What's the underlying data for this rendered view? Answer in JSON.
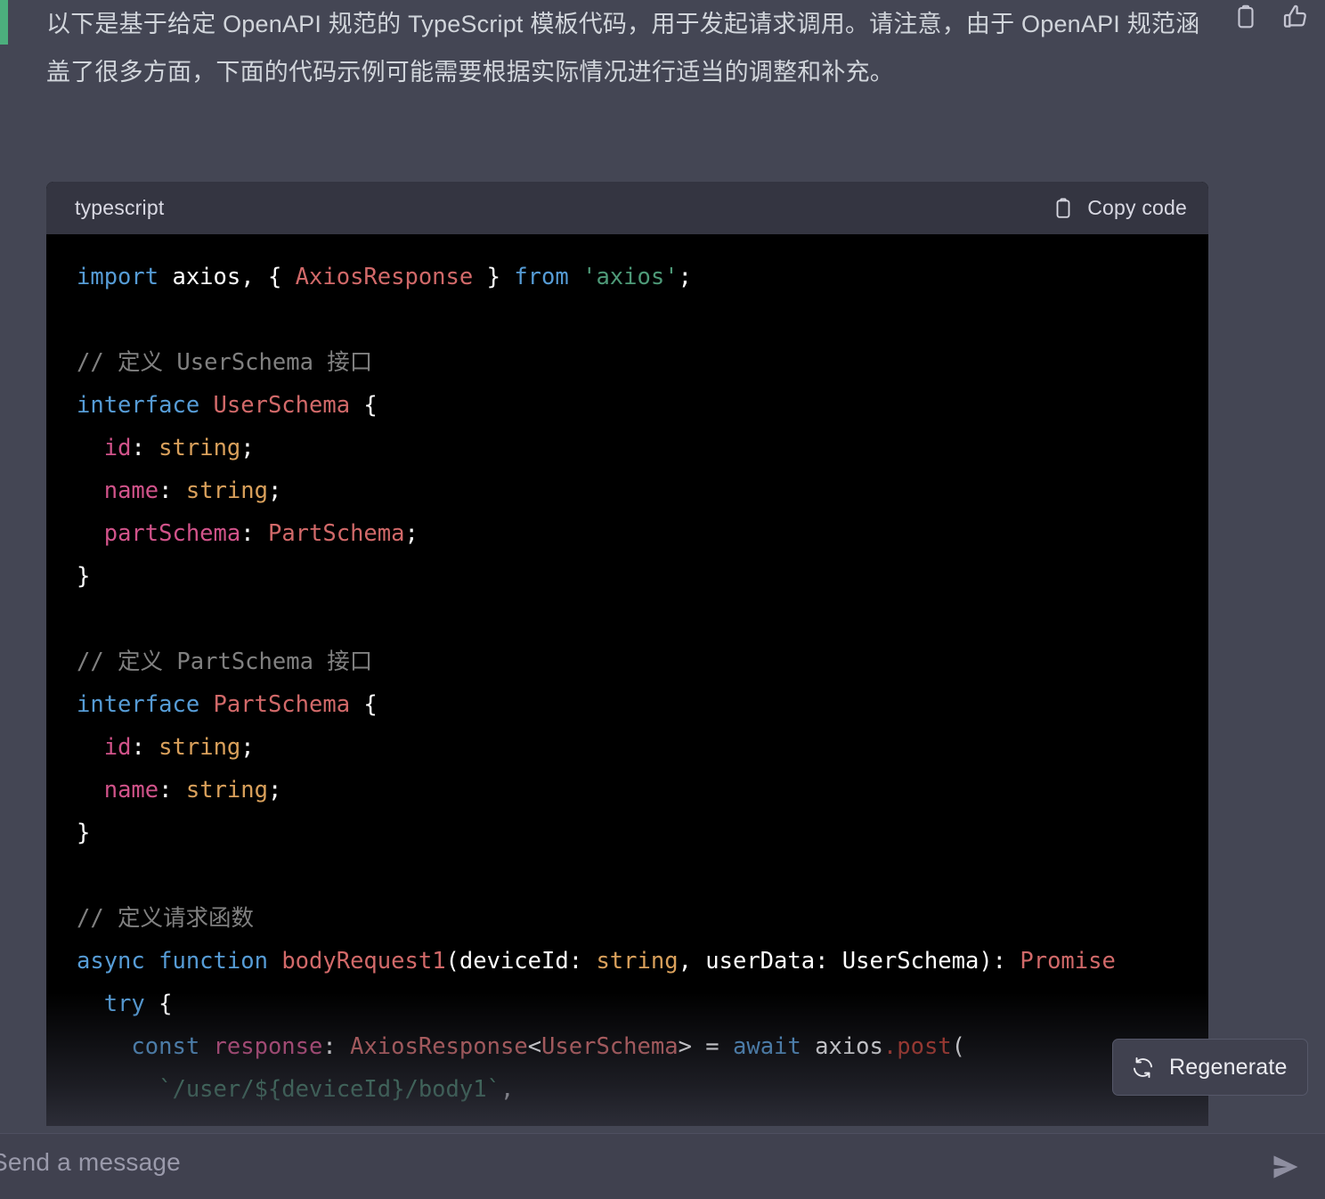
{
  "theme": {
    "page_bg": "#444654",
    "code_header_bg": "#343541",
    "code_body_bg": "#000000",
    "composer_bg": "#40414f",
    "accent_green": "#4caf7d",
    "text_primary": "#d1d5db"
  },
  "message": {
    "body": "以下是基于给定 OpenAPI 规范的 TypeScript 模板代码，用于发起请求调用。请注意，由于 OpenAPI 规范涵盖了很多方面，下面的代码示例可能需要根据实际情况进行适当的调整和补充。",
    "actions": [
      {
        "name": "copy-icon",
        "label": "Copy"
      },
      {
        "name": "thumbs-up-icon",
        "label": "Good response"
      }
    ]
  },
  "code_block": {
    "language": "typescript",
    "copy_label": "Copy code",
    "copy_icon": "clipboard-icon",
    "lines": [
      [
        {
          "t": "import",
          "c": "k"
        },
        {
          "t": " axios, { ",
          "c": "pun"
        },
        {
          "t": "AxiosResponse",
          "c": "cls"
        },
        {
          "t": " } ",
          "c": "pun"
        },
        {
          "t": "from",
          "c": "k"
        },
        {
          "t": " ",
          "c": "pun"
        },
        {
          "t": "'axios'",
          "c": "str"
        },
        {
          "t": ";",
          "c": "pun"
        }
      ],
      [],
      [
        {
          "t": "// 定义 UserSchema 接口",
          "c": "cmt"
        }
      ],
      [
        {
          "t": "interface",
          "c": "k"
        },
        {
          "t": " ",
          "c": "pun"
        },
        {
          "t": "UserSchema",
          "c": "cls"
        },
        {
          "t": " {",
          "c": "pun"
        }
      ],
      [
        {
          "t": "  ",
          "c": "pun"
        },
        {
          "t": "id",
          "c": "prop"
        },
        {
          "t": ": ",
          "c": "pun"
        },
        {
          "t": "string",
          "c": "typ"
        },
        {
          "t": ";",
          "c": "pun"
        }
      ],
      [
        {
          "t": "  ",
          "c": "pun"
        },
        {
          "t": "name",
          "c": "prop"
        },
        {
          "t": ": ",
          "c": "pun"
        },
        {
          "t": "string",
          "c": "typ"
        },
        {
          "t": ";",
          "c": "pun"
        }
      ],
      [
        {
          "t": "  ",
          "c": "pun"
        },
        {
          "t": "partSchema",
          "c": "prop"
        },
        {
          "t": ": ",
          "c": "pun"
        },
        {
          "t": "PartSchema",
          "c": "cls"
        },
        {
          "t": ";",
          "c": "pun"
        }
      ],
      [
        {
          "t": "}",
          "c": "pun"
        }
      ],
      [],
      [
        {
          "t": "// 定义 PartSchema 接口",
          "c": "cmt"
        }
      ],
      [
        {
          "t": "interface",
          "c": "k"
        },
        {
          "t": " ",
          "c": "pun"
        },
        {
          "t": "PartSchema",
          "c": "cls"
        },
        {
          "t": " {",
          "c": "pun"
        }
      ],
      [
        {
          "t": "  ",
          "c": "pun"
        },
        {
          "t": "id",
          "c": "prop"
        },
        {
          "t": ": ",
          "c": "pun"
        },
        {
          "t": "string",
          "c": "typ"
        },
        {
          "t": ";",
          "c": "pun"
        }
      ],
      [
        {
          "t": "  ",
          "c": "pun"
        },
        {
          "t": "name",
          "c": "prop"
        },
        {
          "t": ": ",
          "c": "pun"
        },
        {
          "t": "string",
          "c": "typ"
        },
        {
          "t": ";",
          "c": "pun"
        }
      ],
      [
        {
          "t": "}",
          "c": "pun"
        }
      ],
      [],
      [
        {
          "t": "// 定义请求函数",
          "c": "cmt"
        }
      ],
      [
        {
          "t": "async",
          "c": "k"
        },
        {
          "t": " ",
          "c": "pun"
        },
        {
          "t": "function",
          "c": "k"
        },
        {
          "t": " ",
          "c": "pun"
        },
        {
          "t": "bodyRequest1",
          "c": "cls"
        },
        {
          "t": "(deviceId: ",
          "c": "pun"
        },
        {
          "t": "string",
          "c": "typ"
        },
        {
          "t": ", userData: UserSchema): ",
          "c": "pun"
        },
        {
          "t": "Promise",
          "c": "cls"
        }
      ],
      [
        {
          "t": "  ",
          "c": "pun"
        },
        {
          "t": "try",
          "c": "k"
        },
        {
          "t": " {",
          "c": "pun"
        }
      ],
      [
        {
          "t": "    ",
          "c": "pun"
        },
        {
          "t": "const",
          "c": "k"
        },
        {
          "t": " ",
          "c": "pun"
        },
        {
          "t": "response",
          "c": "prop"
        },
        {
          "t": ": ",
          "c": "pun"
        },
        {
          "t": "AxiosResponse",
          "c": "cls"
        },
        {
          "t": "<",
          "c": "pun"
        },
        {
          "t": "UserSchema",
          "c": "cls"
        },
        {
          "t": "> = ",
          "c": "pun"
        },
        {
          "t": "await",
          "c": "k"
        },
        {
          "t": " axios",
          "c": "pun"
        },
        {
          "t": ".post",
          "c": "mth"
        },
        {
          "t": "(",
          "c": "pun"
        }
      ],
      [
        {
          "t": "      ",
          "c": "pun"
        },
        {
          "t": "`/user/${deviceId}/body1`",
          "c": "str"
        },
        {
          "t": ",",
          "c": "pun"
        }
      ]
    ]
  },
  "regenerate": {
    "label": "Regenerate",
    "icon": "refresh-icon"
  },
  "composer": {
    "placeholder": "Send a message",
    "value": "",
    "send_icon": "send-icon"
  }
}
